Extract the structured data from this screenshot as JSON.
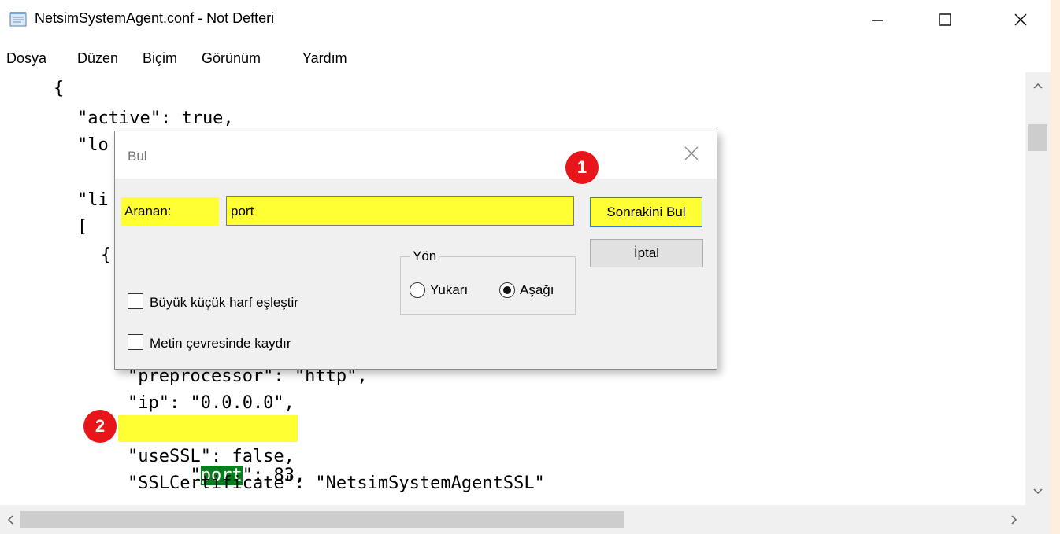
{
  "window": {
    "title": "NetsimSystemAgent.conf - Not Defteri",
    "controls": [
      "minimize",
      "maximize",
      "close"
    ]
  },
  "menu": [
    "Dosya",
    "Düzen",
    "Biçim",
    "Görünüm",
    "Yardım"
  ],
  "editor": {
    "lines": [
      "{",
      "\"active\": true,",
      "\"lo",
      "",
      "\"li",
      "[",
      "{",
      "",
      "",
      "",
      "\"preprocessor\": \"http\",",
      "\"ip\": \"0.0.0.0\",",
      "\"port\": 83,",
      "\"useSSL\": false,",
      "\"SSLCertificate\": \"NetsimSystemAgentSSL\""
    ],
    "highlighted_line_index": 12,
    "found_text": "port"
  },
  "find_dialog": {
    "title": "Bul",
    "search_label": "Aranan:",
    "search_value": "port",
    "find_next_label": "Sonrakini Bul",
    "cancel_label": "İptal",
    "direction_group": "Yön",
    "direction_up": "Yukarı",
    "direction_down": "Aşağı",
    "selected_direction": "Aşağı",
    "match_case_label": "Büyük küçük harf eşleştir",
    "match_case_checked": false,
    "wrap_label": "Metin çevresinde kaydır",
    "wrap_checked": false
  },
  "annotations": [
    "1",
    "2"
  ],
  "colors": {
    "highlight_yellow": "#ffff33",
    "find_match_bg": "#0a7d1f",
    "badge_red": "#e8161b",
    "dialog_bg": "#f0f0f0"
  },
  "icons": [
    "notepad-icon",
    "minimize-icon",
    "maximize-icon",
    "close-icon",
    "dialog-close-icon",
    "scroll-up-icon",
    "scroll-down-icon",
    "scroll-left-icon",
    "scroll-right-icon"
  ]
}
